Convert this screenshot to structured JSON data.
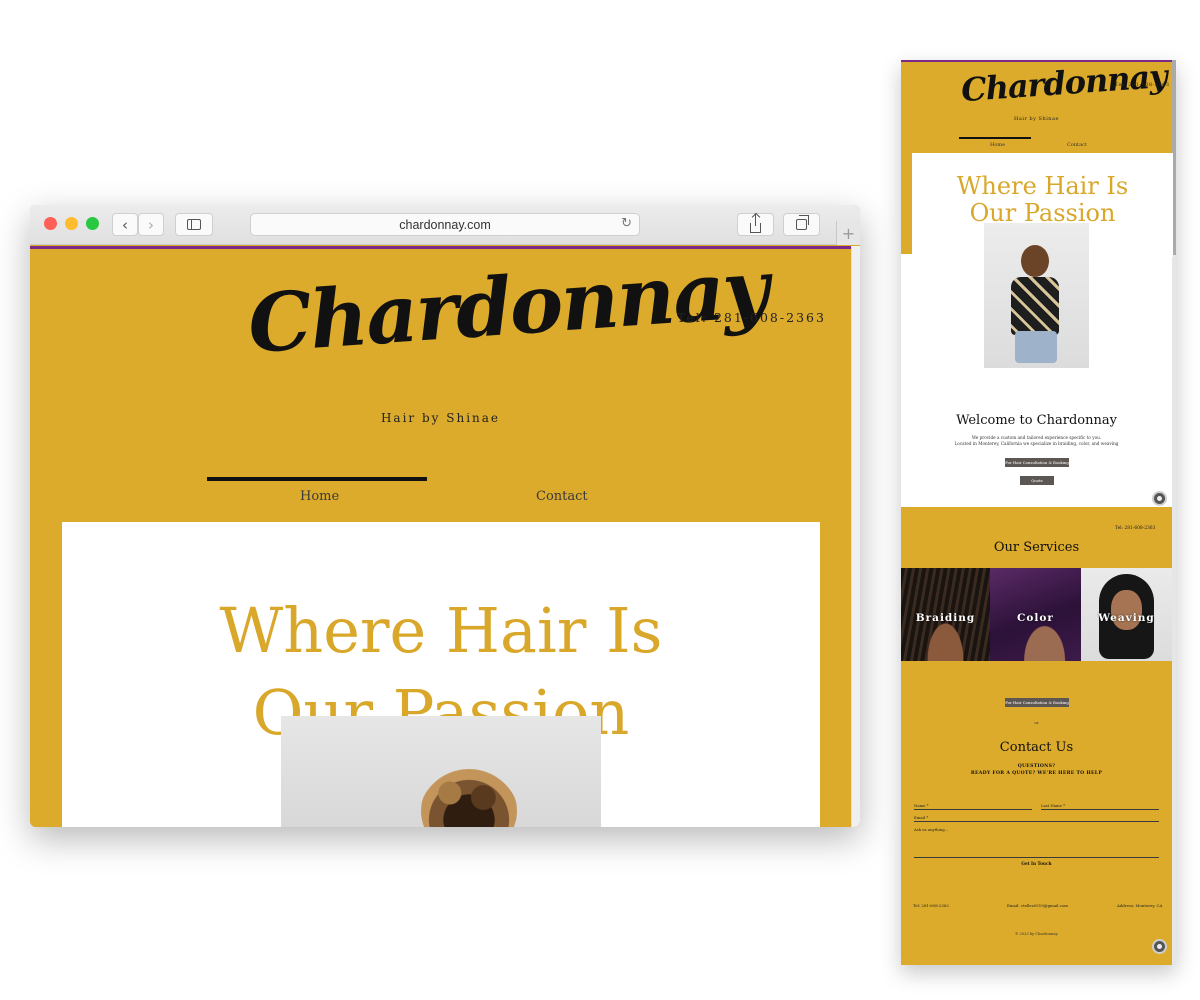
{
  "browser": {
    "url": "chardonnay.com",
    "reload_glyph": "↻",
    "new_tab_glyph": "+",
    "icons": [
      "back-icon",
      "forward-icon",
      "sidebar-icon",
      "share-icon",
      "tabs-icon",
      "reload-icon",
      "new-tab-icon"
    ]
  },
  "site": {
    "logo_text": "Chardonnay",
    "tel": "Tel: 281-608-2363",
    "tagline": "Hair by Shinae",
    "nav": [
      {
        "label": "Home",
        "active": true
      },
      {
        "label": "Contact",
        "active": false
      }
    ],
    "hero_title_line1": "Where Hair Is",
    "hero_title_line2": "Our Passion",
    "colors": {
      "gold": "#dcab2b",
      "accent_purple": "#7c2a87",
      "title_gold": "#d9a72a",
      "button_gray": "#5d5753"
    }
  },
  "mobile": {
    "logo_text": "Chardonnay",
    "tel": "Tel: 281-608-2363",
    "tagline": "Hair by Shinae",
    "nav": [
      "Home",
      "Contact"
    ],
    "hero_title_line1": "Where Hair Is",
    "hero_title_line2": "Our Passion",
    "welcome_title": "Welcome to Chardonnay",
    "welcome_line1": "We provide a custom and tailored experience specific to you.",
    "welcome_line2": "Located in Monterey, California we specialize in braiding, color, and weaving",
    "consult_button": "For Hair Consultation & Booking",
    "quote_button": "Quote",
    "tel_secondary": "Tel: 281-608-2363",
    "services_title": "Our Services",
    "services": [
      "Braiding",
      "Color",
      "Weaving"
    ],
    "consult_button_2": "For Hair Consultation & Booking",
    "or_text": "or",
    "contact_title": "Contact Us",
    "questions_line1": "QUESTIONS?",
    "questions_line2": "READY FOR A QUOTE? WE'RE HERE TO HELP",
    "form": {
      "first_name": "Name *",
      "last_name": "Last Name *",
      "email": "Email *",
      "message": "Ask us anything...",
      "submit": "Get In Touch"
    },
    "footer": {
      "tel": "Tel: 281-608-2363",
      "email": "Email: ctellez0519@gmail.com",
      "address": "Address: Monterey, CA"
    },
    "copyright": "© 2023 by Chardonnay."
  }
}
